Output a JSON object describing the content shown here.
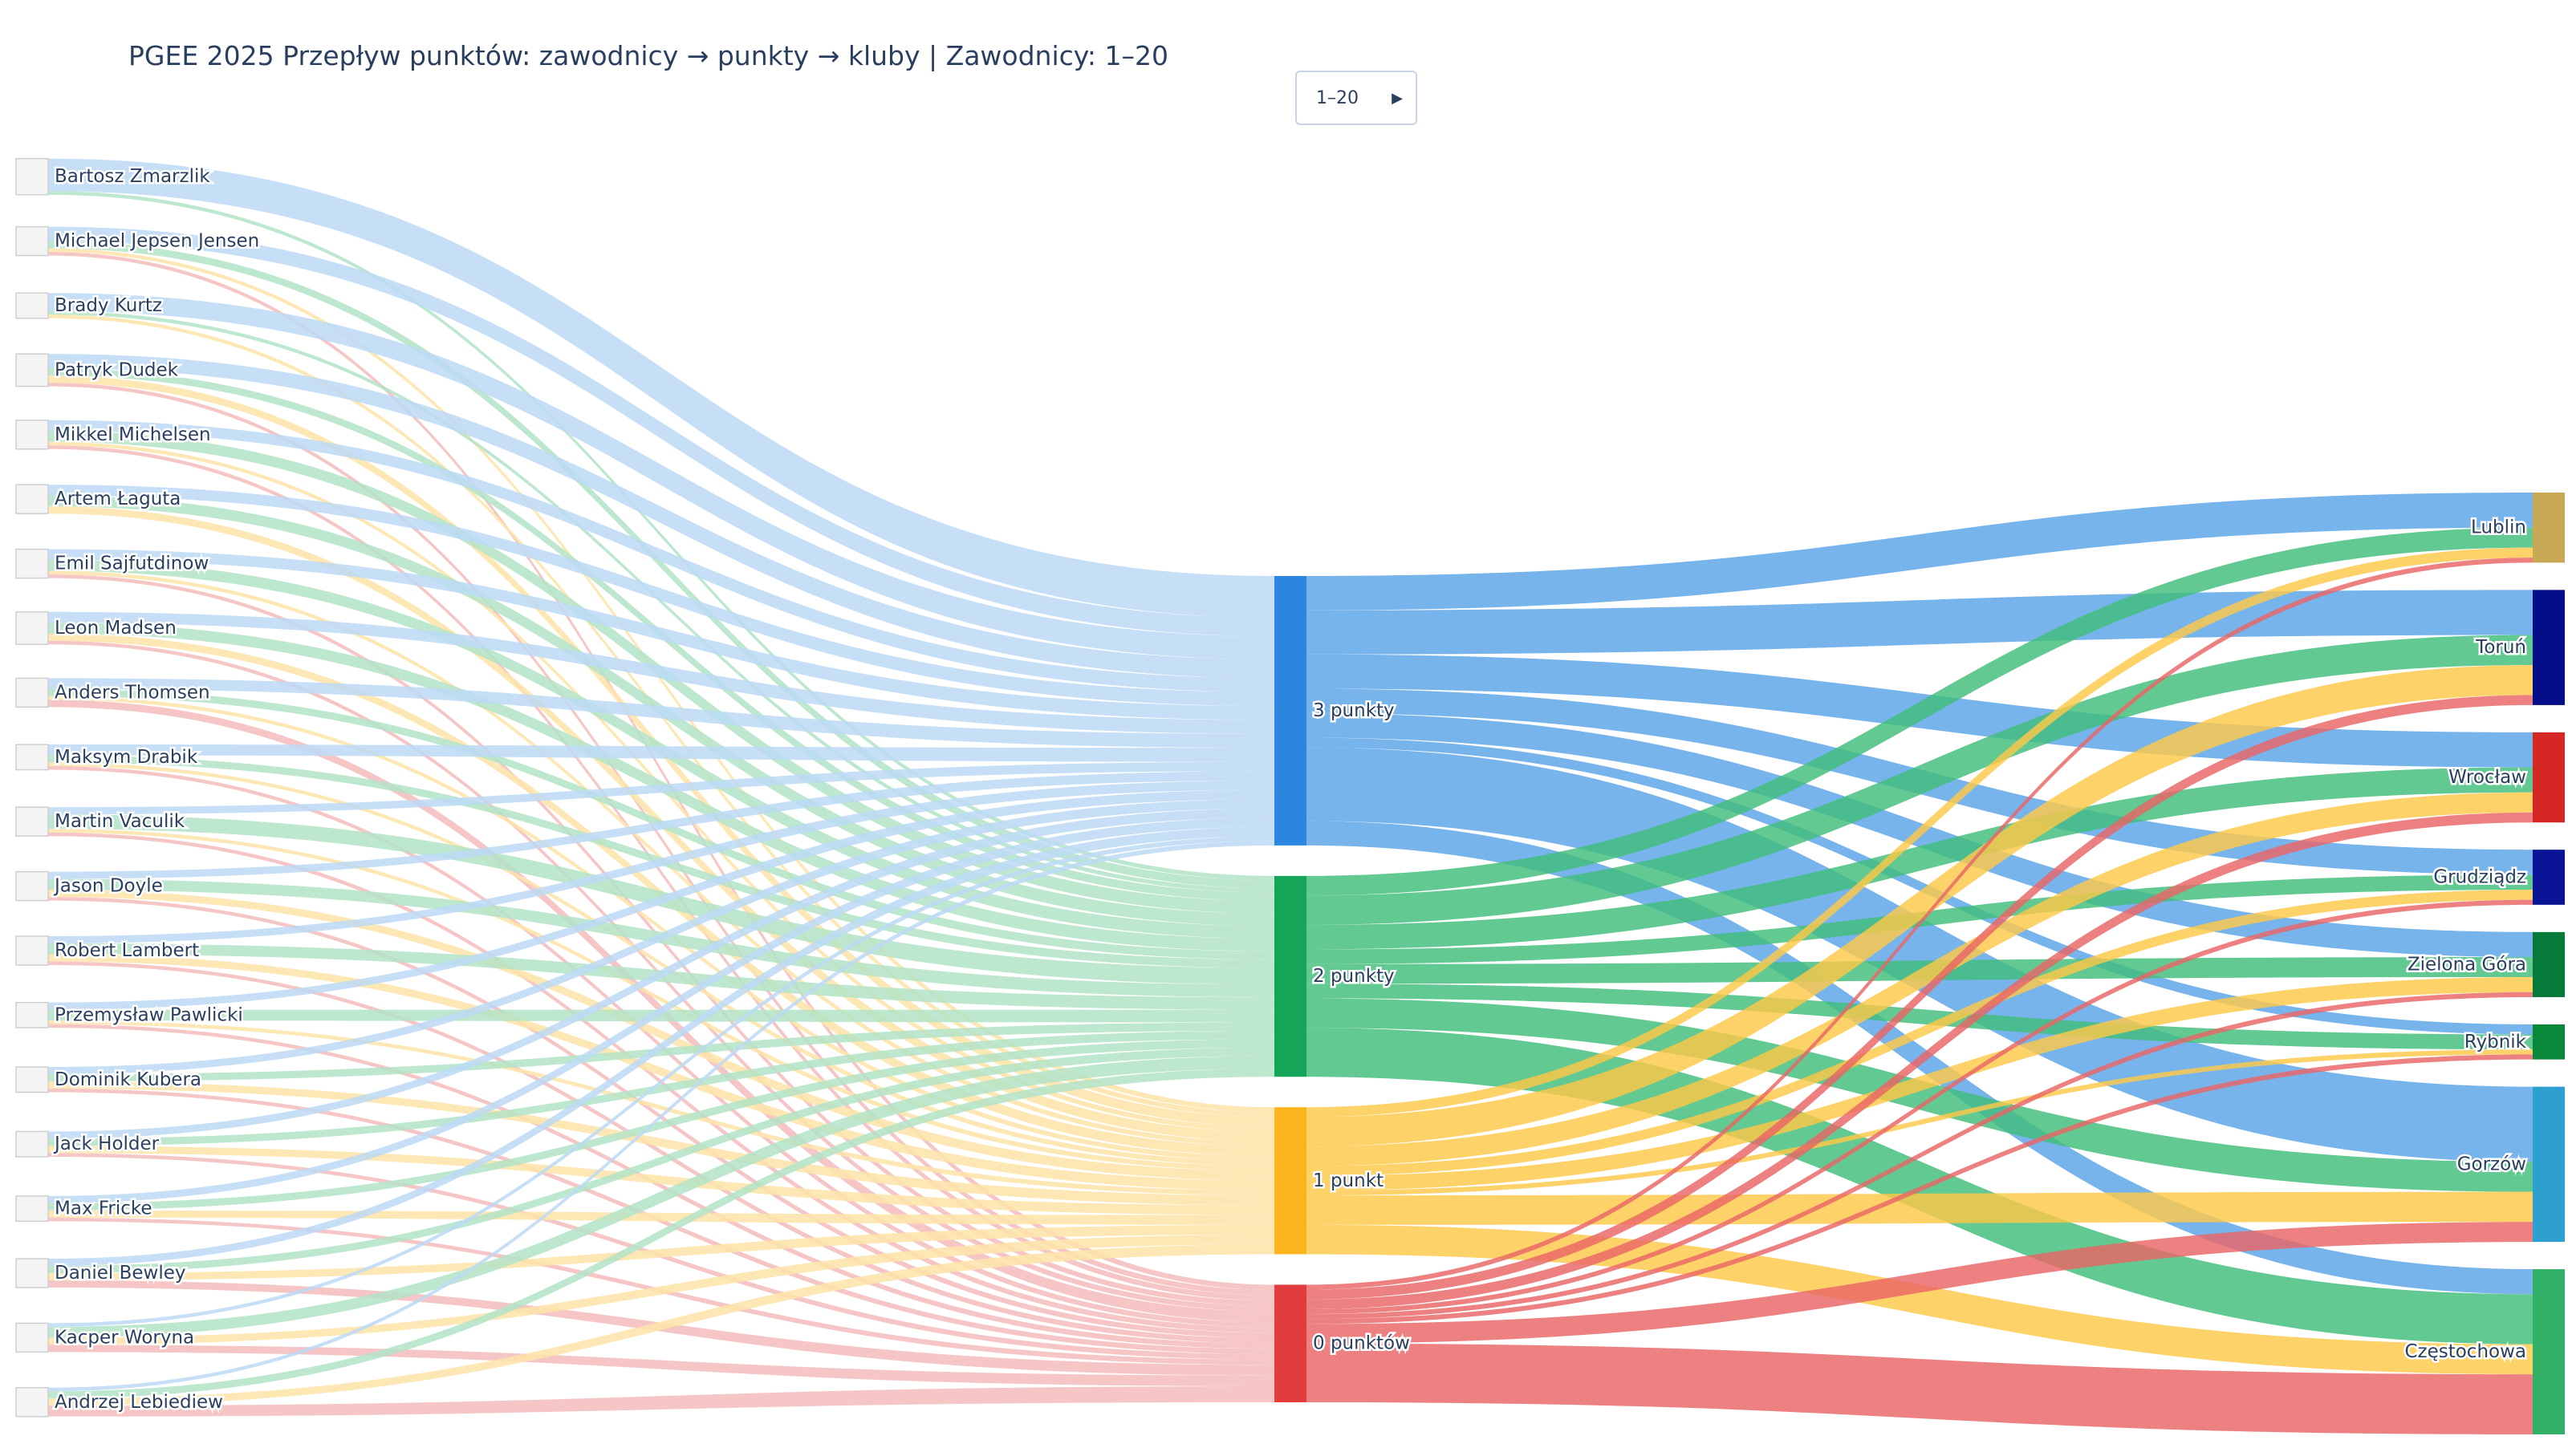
{
  "title": "PGEE 2025 Przepływ punktów: zawodnicy → punkty → kluby | Zawodnicy: 1–20",
  "range_control": {
    "label": "1–20",
    "icon": "play-arrow-icon"
  },
  "chart_data": {
    "type": "sankey",
    "title": "PGEE 2025 Przepływ punktów: zawodnicy → punkty → kluby | Zawodnicy: 1–20",
    "riders": [
      {
        "name": "Bartosz Zmarzlik",
        "p3": 9,
        "p2": 1,
        "p1": 0,
        "p0": 0
      },
      {
        "name": "Michael Jepsen Jensen",
        "p3": 4,
        "p2": 2,
        "p1": 1,
        "p0": 1
      },
      {
        "name": "Brady Kurtz",
        "p3": 5,
        "p2": 1,
        "p1": 1,
        "p0": 0
      },
      {
        "name": "Patryk Dudek",
        "p3": 4,
        "p2": 2,
        "p1": 2,
        "p0": 1
      },
      {
        "name": "Mikkel Michelsen",
        "p3": 3,
        "p2": 3,
        "p1": 1,
        "p0": 1
      },
      {
        "name": "Artem Łaguta",
        "p3": 3,
        "p2": 3,
        "p1": 2,
        "p0": 0
      },
      {
        "name": "Emil Sajfutdinow",
        "p3": 3,
        "p2": 3,
        "p1": 1,
        "p0": 1
      },
      {
        "name": "Leon Madsen",
        "p3": 3,
        "p2": 3,
        "p1": 2,
        "p0": 1
      },
      {
        "name": "Anders Thomsen",
        "p3": 3,
        "p2": 2,
        "p1": 1,
        "p0": 2
      },
      {
        "name": "Maksym Drabik",
        "p3": 3,
        "p2": 2,
        "p1": 1,
        "p0": 1
      },
      {
        "name": "Martin Vaculik",
        "p3": 2,
        "p2": 4,
        "p1": 1,
        "p0": 1
      },
      {
        "name": "Jason Doyle",
        "p3": 2,
        "p2": 3,
        "p1": 2,
        "p0": 1
      },
      {
        "name": "Robert Lambert",
        "p3": 2,
        "p2": 3,
        "p1": 2,
        "p0": 1
      },
      {
        "name": "Przemysław Pawlicki",
        "p3": 2,
        "p2": 3,
        "p1": 1,
        "p0": 1
      },
      {
        "name": "Dominik Kubera",
        "p3": 2,
        "p2": 2,
        "p1": 2,
        "p0": 1
      },
      {
        "name": "Jack Holder",
        "p3": 2,
        "p2": 2,
        "p1": 2,
        "p0": 1
      },
      {
        "name": "Max Fricke",
        "p3": 2,
        "p2": 2,
        "p1": 2,
        "p0": 1
      },
      {
        "name": "Daniel Bewley",
        "p3": 2,
        "p2": 2,
        "p1": 2,
        "p0": 2
      },
      {
        "name": "Kacper Woryna",
        "p3": 1,
        "p2": 3,
        "p1": 2,
        "p0": 2
      },
      {
        "name": "Andrzej Lebiediew",
        "p3": 1,
        "p2": 2,
        "p1": 2,
        "p0": 3
      }
    ],
    "points": [
      {
        "name": "3 punkty",
        "key": "p3",
        "color": "#2b86e0",
        "link": "#5aa4e8",
        "link_light": "#bcd9f5"
      },
      {
        "name": "2 punkty",
        "key": "p2",
        "color": "#15a558",
        "link": "#41bd7a",
        "link_light": "#b3e3c7"
      },
      {
        "name": "1 punkt",
        "key": "p1",
        "color": "#fbb41c",
        "link": "#fcc848",
        "link_light": "#fde4a8"
      },
      {
        "name": "0 punktów",
        "key": "p0",
        "color": "#e23c3c",
        "link": "#e96565",
        "link_light": "#f5bcbc"
      }
    ],
    "clubs": [
      {
        "name": "Lublin",
        "color": "#c9a955"
      },
      {
        "name": "Toruń",
        "color": "#040c88"
      },
      {
        "name": "Wrocław",
        "color": "#d52724"
      },
      {
        "name": "Grudziądz",
        "color": "#0a1295"
      },
      {
        "name": "Zielona Góra",
        "color": "#067a3a"
      },
      {
        "name": "Rybnik",
        "color": "#09883a"
      },
      {
        "name": "Gorzów",
        "color": "#2ea0cf"
      },
      {
        "name": "Częstochowa",
        "color": "#33b067"
      }
    ],
    "point_to_club": [
      {
        "source": "3 punkty",
        "target": "Lublin",
        "value": 7
      },
      {
        "source": "3 punkty",
        "target": "Toruń",
        "value": 9
      },
      {
        "source": "3 punkty",
        "target": "Wrocław",
        "value": 7
      },
      {
        "source": "3 punkty",
        "target": "Grudziądz",
        "value": 5
      },
      {
        "source": "3 punkty",
        "target": "Zielona Góra",
        "value": 5
      },
      {
        "source": "3 punkty",
        "target": "Rybnik",
        "value": 2
      },
      {
        "source": "3 punkty",
        "target": "Gorzów",
        "value": 15
      },
      {
        "source": "3 punkty",
        "target": "Częstochowa",
        "value": 5
      },
      {
        "source": "2 punkty",
        "target": "Lublin",
        "value": 4
      },
      {
        "source": "2 punkty",
        "target": "Toruń",
        "value": 6
      },
      {
        "source": "2 punkty",
        "target": "Wrocław",
        "value": 5
      },
      {
        "source": "2 punkty",
        "target": "Grudziądz",
        "value": 3
      },
      {
        "source": "2 punkty",
        "target": "Zielona Góra",
        "value": 4
      },
      {
        "source": "2 punkty",
        "target": "Rybnik",
        "value": 3
      },
      {
        "source": "2 punkty",
        "target": "Gorzów",
        "value": 6
      },
      {
        "source": "2 punkty",
        "target": "Częstochowa",
        "value": 10
      },
      {
        "source": "1 punkt",
        "target": "Lublin",
        "value": 2
      },
      {
        "source": "1 punkt",
        "target": "Toruń",
        "value": 6
      },
      {
        "source": "1 punkt",
        "target": "Wrocław",
        "value": 4
      },
      {
        "source": "1 punkt",
        "target": "Grudziądz",
        "value": 2
      },
      {
        "source": "1 punkt",
        "target": "Zielona Góra",
        "value": 3
      },
      {
        "source": "1 punkt",
        "target": "Rybnik",
        "value": 1
      },
      {
        "source": "1 punkt",
        "target": "Gorzów",
        "value": 6
      },
      {
        "source": "1 punkt",
        "target": "Częstochowa",
        "value": 6
      },
      {
        "source": "0 punktów",
        "target": "Lublin",
        "value": 1
      },
      {
        "source": "0 punktów",
        "target": "Toruń",
        "value": 2
      },
      {
        "source": "0 punktów",
        "target": "Wrocław",
        "value": 2
      },
      {
        "source": "0 punktów",
        "target": "Grudziądz",
        "value": 1
      },
      {
        "source": "0 punktów",
        "target": "Zielona Góra",
        "value": 1
      },
      {
        "source": "0 punktów",
        "target": "Rybnik",
        "value": 1
      },
      {
        "source": "0 punktów",
        "target": "Gorzów",
        "value": 4
      },
      {
        "source": "0 punktów",
        "target": "Częstochowa",
        "value": 12
      }
    ]
  }
}
